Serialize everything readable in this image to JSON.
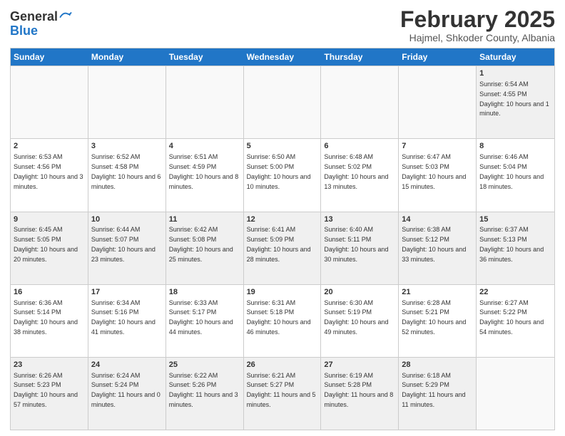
{
  "logo": {
    "general": "General",
    "blue": "Blue"
  },
  "title": "February 2025",
  "location": "Hajmel, Shkoder County, Albania",
  "days_of_week": [
    "Sunday",
    "Monday",
    "Tuesday",
    "Wednesday",
    "Thursday",
    "Friday",
    "Saturday"
  ],
  "weeks": [
    [
      {
        "day": "",
        "info": ""
      },
      {
        "day": "",
        "info": ""
      },
      {
        "day": "",
        "info": ""
      },
      {
        "day": "",
        "info": ""
      },
      {
        "day": "",
        "info": ""
      },
      {
        "day": "",
        "info": ""
      },
      {
        "day": "1",
        "info": "Sunrise: 6:54 AM\nSunset: 4:55 PM\nDaylight: 10 hours and 1 minute."
      }
    ],
    [
      {
        "day": "2",
        "info": "Sunrise: 6:53 AM\nSunset: 4:56 PM\nDaylight: 10 hours and 3 minutes."
      },
      {
        "day": "3",
        "info": "Sunrise: 6:52 AM\nSunset: 4:58 PM\nDaylight: 10 hours and 6 minutes."
      },
      {
        "day": "4",
        "info": "Sunrise: 6:51 AM\nSunset: 4:59 PM\nDaylight: 10 hours and 8 minutes."
      },
      {
        "day": "5",
        "info": "Sunrise: 6:50 AM\nSunset: 5:00 PM\nDaylight: 10 hours and 10 minutes."
      },
      {
        "day": "6",
        "info": "Sunrise: 6:48 AM\nSunset: 5:02 PM\nDaylight: 10 hours and 13 minutes."
      },
      {
        "day": "7",
        "info": "Sunrise: 6:47 AM\nSunset: 5:03 PM\nDaylight: 10 hours and 15 minutes."
      },
      {
        "day": "8",
        "info": "Sunrise: 6:46 AM\nSunset: 5:04 PM\nDaylight: 10 hours and 18 minutes."
      }
    ],
    [
      {
        "day": "9",
        "info": "Sunrise: 6:45 AM\nSunset: 5:05 PM\nDaylight: 10 hours and 20 minutes."
      },
      {
        "day": "10",
        "info": "Sunrise: 6:44 AM\nSunset: 5:07 PM\nDaylight: 10 hours and 23 minutes."
      },
      {
        "day": "11",
        "info": "Sunrise: 6:42 AM\nSunset: 5:08 PM\nDaylight: 10 hours and 25 minutes."
      },
      {
        "day": "12",
        "info": "Sunrise: 6:41 AM\nSunset: 5:09 PM\nDaylight: 10 hours and 28 minutes."
      },
      {
        "day": "13",
        "info": "Sunrise: 6:40 AM\nSunset: 5:11 PM\nDaylight: 10 hours and 30 minutes."
      },
      {
        "day": "14",
        "info": "Sunrise: 6:38 AM\nSunset: 5:12 PM\nDaylight: 10 hours and 33 minutes."
      },
      {
        "day": "15",
        "info": "Sunrise: 6:37 AM\nSunset: 5:13 PM\nDaylight: 10 hours and 36 minutes."
      }
    ],
    [
      {
        "day": "16",
        "info": "Sunrise: 6:36 AM\nSunset: 5:14 PM\nDaylight: 10 hours and 38 minutes."
      },
      {
        "day": "17",
        "info": "Sunrise: 6:34 AM\nSunset: 5:16 PM\nDaylight: 10 hours and 41 minutes."
      },
      {
        "day": "18",
        "info": "Sunrise: 6:33 AM\nSunset: 5:17 PM\nDaylight: 10 hours and 44 minutes."
      },
      {
        "day": "19",
        "info": "Sunrise: 6:31 AM\nSunset: 5:18 PM\nDaylight: 10 hours and 46 minutes."
      },
      {
        "day": "20",
        "info": "Sunrise: 6:30 AM\nSunset: 5:19 PM\nDaylight: 10 hours and 49 minutes."
      },
      {
        "day": "21",
        "info": "Sunrise: 6:28 AM\nSunset: 5:21 PM\nDaylight: 10 hours and 52 minutes."
      },
      {
        "day": "22",
        "info": "Sunrise: 6:27 AM\nSunset: 5:22 PM\nDaylight: 10 hours and 54 minutes."
      }
    ],
    [
      {
        "day": "23",
        "info": "Sunrise: 6:26 AM\nSunset: 5:23 PM\nDaylight: 10 hours and 57 minutes."
      },
      {
        "day": "24",
        "info": "Sunrise: 6:24 AM\nSunset: 5:24 PM\nDaylight: 11 hours and 0 minutes."
      },
      {
        "day": "25",
        "info": "Sunrise: 6:22 AM\nSunset: 5:26 PM\nDaylight: 11 hours and 3 minutes."
      },
      {
        "day": "26",
        "info": "Sunrise: 6:21 AM\nSunset: 5:27 PM\nDaylight: 11 hours and 5 minutes."
      },
      {
        "day": "27",
        "info": "Sunrise: 6:19 AM\nSunset: 5:28 PM\nDaylight: 11 hours and 8 minutes."
      },
      {
        "day": "28",
        "info": "Sunrise: 6:18 AM\nSunset: 5:29 PM\nDaylight: 11 hours and 11 minutes."
      },
      {
        "day": "",
        "info": ""
      }
    ]
  ]
}
